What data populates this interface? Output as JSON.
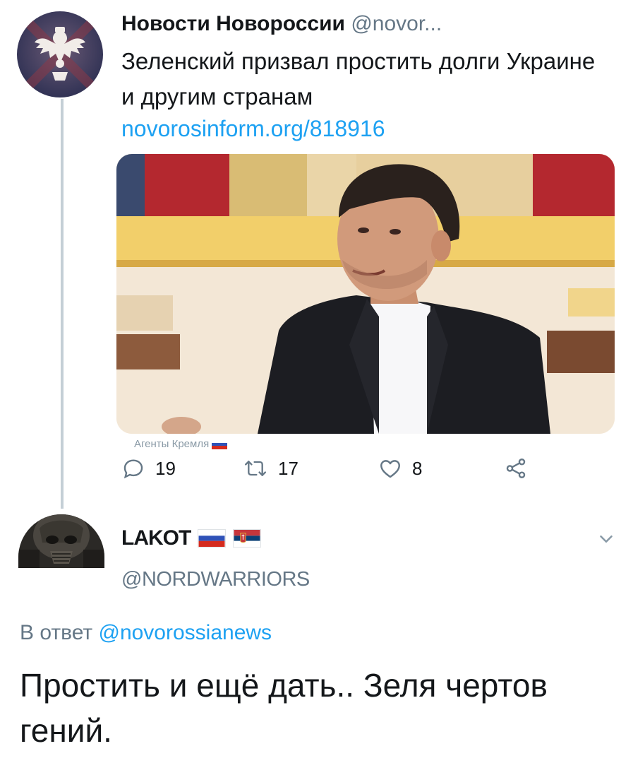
{
  "tweet1": {
    "author_name": "Новости Новороссии",
    "author_handle": "@novor...",
    "text": "Зеленский призвал простить долги Украине и другим странам",
    "link": "novorosinform.org/818916",
    "watermark": "Агенты Кремля",
    "actions": {
      "reply_count": "19",
      "retweet_count": "17",
      "like_count": "8"
    }
  },
  "tweet2": {
    "author_name": "LAKOT",
    "author_handle": "@NORDWARRIORS",
    "reply_prefix": "В ответ",
    "reply_mention": "@novorossianews",
    "text": "Простить и ещё дать.. Зеля чертов гений."
  },
  "colors": {
    "link": "#1da1f2",
    "secondary_text": "#657786",
    "primary_text": "#14171a",
    "thread_line": "#c4cfd6"
  },
  "icons": [
    "reply-icon",
    "retweet-icon",
    "like-icon",
    "share-icon",
    "chevron-down-icon",
    "russia-flag-icon",
    "serbia-flag-icon"
  ]
}
